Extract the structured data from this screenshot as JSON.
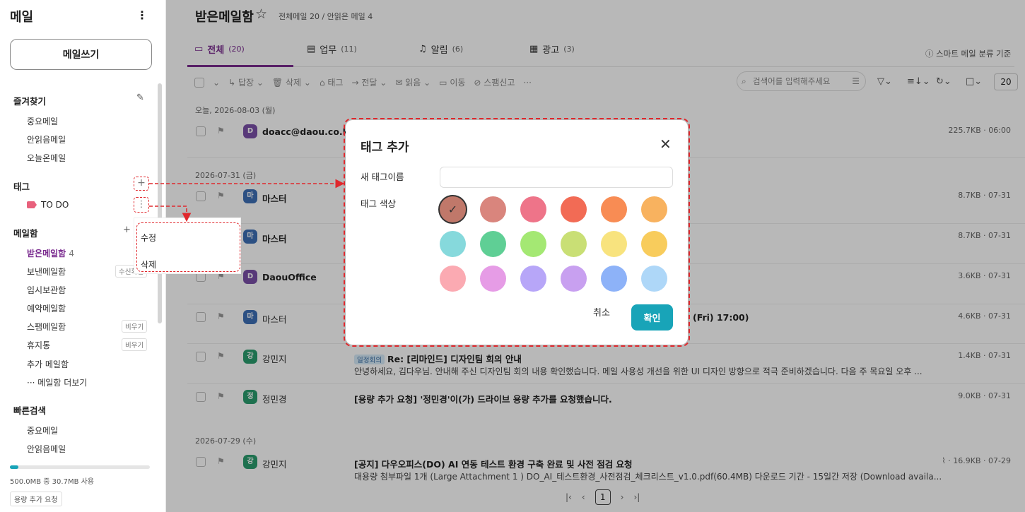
{
  "sidebar": {
    "title": "메일",
    "compose_label": "메일쓰기",
    "favorites": {
      "title": "즐겨찾기",
      "items": [
        "중요메일",
        "안읽음메일",
        "오늘온메일"
      ]
    },
    "tags": {
      "title": "태그",
      "items": [
        "TO DO"
      ]
    },
    "mailboxes": {
      "title": "메일함",
      "items": [
        {
          "label": "받은메일함",
          "count": "4"
        },
        {
          "label": "보낸메일함",
          "badge": "수신확인"
        },
        {
          "label": "임시보관함"
        },
        {
          "label": "예약메일함"
        },
        {
          "label": "스팸메일함",
          "badge": "비우기"
        },
        {
          "label": "휴지통",
          "badge": "비우기"
        },
        {
          "label": "추가 메일함"
        },
        {
          "label": "··· 메일함 더보기"
        }
      ]
    },
    "quick_search": {
      "title": "빠른검색",
      "items": [
        "중요메일",
        "안읽음메일"
      ]
    },
    "storage": {
      "text": "500.0MB 중 30.7MB 사용",
      "button": "용량 추가 요청",
      "used_fraction": 0.06
    }
  },
  "context_menu": {
    "items": [
      "수정",
      "삭제"
    ]
  },
  "main": {
    "title": "받은메일함",
    "subtitle": "전체메일 20 / 안읽은 메일 4",
    "tabs": [
      {
        "label": "전체",
        "count": "(20)"
      },
      {
        "label": "업무",
        "count": "(11)"
      },
      {
        "label": "알림",
        "count": "(6)"
      },
      {
        "label": "광고",
        "count": "(3)"
      }
    ],
    "smart_sort": "스마트 메일 분류 기준",
    "toolbar": [
      "답장",
      "삭제",
      "태그",
      "전달",
      "읽음",
      "이동",
      "스팸신고",
      "···"
    ],
    "search_placeholder": "검색어를 입력해주세요",
    "page_size": "20",
    "date_groups": [
      "오늘, 2026-08-03 (월)",
      "2026-07-31 (금)",
      "2026-07-29 (수)"
    ],
    "mails": [
      {
        "avatar": "D",
        "sender": "doacc@daou.co.kr",
        "subject": "",
        "meta": "225.7KB · 06:00",
        "color": "#7b4fa8"
      },
      {
        "avatar": "마",
        "sender": "마스터",
        "subject": "",
        "meta": "8.7KB · 07-31",
        "color": "#3e6fb6"
      },
      {
        "avatar": "마",
        "sender": "마스터",
        "subject": "",
        "meta": "8.7KB · 07-31",
        "color": "#3e6fb6"
      },
      {
        "avatar": "D",
        "sender": "DaouOffice",
        "subject": "",
        "meta": "3.6KB · 07-31",
        "color": "#7b4fa8"
      },
      {
        "avatar": "마",
        "sender": "마스터",
        "subject": "(Fri) 17:00)",
        "meta": "4.6KB · 07-31",
        "color": "#3e6fb6"
      },
      {
        "avatar": "강",
        "sender": "강민지",
        "chip": "일정회의",
        "subject": "Re: [리마인드] 디자인팀 회의 안내",
        "snippet": "안녕하세요, 김다우님. 안내해 주신 디자인팀 회의 내용 확인했습니다. 메일 사용성 개선을 위한 UI 디자인 방향으로 적극 준비하겠습니다. 다음 주 목요일 오후 ...",
        "meta": "1.4KB · 07-31",
        "color": "#2a9d6e"
      },
      {
        "avatar": "정",
        "sender": "정민경",
        "subject": "[용량 추가 요청] '정민경'이(가) 드라이브 용량 추가를 요청했습니다.",
        "meta": "9.0KB · 07-31",
        "color": "#2a9d6e"
      },
      {
        "avatar": "강",
        "sender": "강민지",
        "subject": "[공지] 다우오피스(DO) AI 연동 테스트 환경 구축 완료 및 사전 점검 요청",
        "snippet": "대용량 첨부파일 1개 (Large Attachment 1 ) DO_AI_테스트환경_사전점검_체크리스트_v1.0.pdf(60.4MB) 다운로드 기간 - 15일간 저장 (Download availa...",
        "meta": "· 16.9KB · 07-29",
        "color": "#2a9d6e"
      }
    ],
    "pager": {
      "current": "1"
    }
  },
  "dialog": {
    "title": "태그 추가",
    "name_label": "새 태그이름",
    "name_value": "",
    "color_label": "태그 색상",
    "colors": [
      "#c0786a",
      "#d9857d",
      "#ee7489",
      "#f26b55",
      "#f88c54",
      "#f8b25f",
      "#86d9dc",
      "#5fcf95",
      "#a4e873",
      "#c9df75",
      "#f8e37e",
      "#f8cc5c",
      "#fbaab2",
      "#e69ce6",
      "#b7a6f8",
      "#c8a0f0",
      "#8db2f8",
      "#aed7f8"
    ],
    "selected_color": "#c0786a",
    "cancel_label": "취소",
    "ok_label": "확인"
  }
}
